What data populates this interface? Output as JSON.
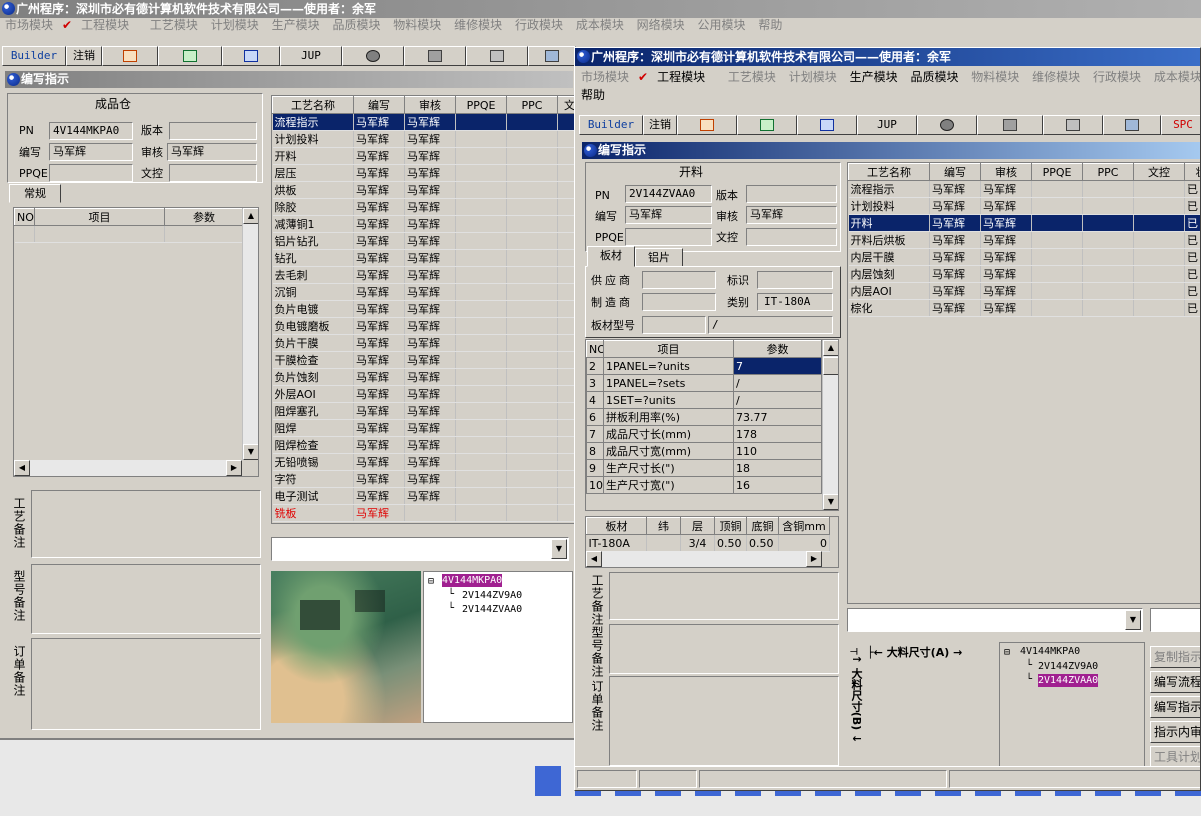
{
  "app_title": "广州程序：深圳市必有德计算机软件技术有限公司——使用者：余军",
  "menu": [
    "市场模块",
    "工程模块",
    "工艺模块",
    "计划模块",
    "生产模块",
    "品质模块",
    "物料模块",
    "维修模块",
    "行政模块",
    "成本模块",
    "网络模块",
    "公用模块",
    "帮助"
  ],
  "menu_front": [
    "市场模块",
    "工程模块",
    "工艺模块",
    "计划模块",
    "生产模块",
    "品质模块",
    "物料模块",
    "维修模块",
    "行政模块",
    "成本模块"
  ],
  "menu_front_help": "帮助",
  "toolbar": {
    "builder": "Builder",
    "logout": "注销",
    "jup": "JUP",
    "spc": "SPC"
  },
  "doc_title": "编写指示",
  "back": {
    "section": "成品仓",
    "pn_label": "PN",
    "pn": "4V144MKPA0",
    "ver_label": "版本",
    "ver": "",
    "writer_label": "编写",
    "writer": "马军辉",
    "review_label": "审核",
    "review": "马军辉",
    "ppqe_label": "PPQE",
    "ppqe": "",
    "doc_label": "文控",
    "doc": "",
    "tab": "常规",
    "param_headers": [
      "NO",
      "项目",
      "参数"
    ],
    "process_headers": [
      "工艺名称",
      "编写",
      "审核",
      "PPQE",
      "PPC",
      "文"
    ],
    "processes": [
      [
        "流程指示",
        "马军辉",
        "马军辉"
      ],
      [
        "计划投料",
        "马军辉",
        "马军辉"
      ],
      [
        "开料",
        "马军辉",
        "马军辉"
      ],
      [
        "层压",
        "马军辉",
        "马军辉"
      ],
      [
        "烘板",
        "马军辉",
        "马军辉"
      ],
      [
        "除胶",
        "马军辉",
        "马军辉"
      ],
      [
        "减薄铜1",
        "马军辉",
        "马军辉"
      ],
      [
        "铝片钻孔",
        "马军辉",
        "马军辉"
      ],
      [
        "钻孔",
        "马军辉",
        "马军辉"
      ],
      [
        "去毛刺",
        "马军辉",
        "马军辉"
      ],
      [
        "沉铜",
        "马军辉",
        "马军辉"
      ],
      [
        "负片电镀",
        "马军辉",
        "马军辉"
      ],
      [
        "负电镀磨板",
        "马军辉",
        "马军辉"
      ],
      [
        "负片干膜",
        "马军辉",
        "马军辉"
      ],
      [
        "干膜检查",
        "马军辉",
        "马军辉"
      ],
      [
        "负片蚀刻",
        "马军辉",
        "马军辉"
      ],
      [
        "外层AOI",
        "马军辉",
        "马军辉"
      ],
      [
        "阻焊塞孔",
        "马军辉",
        "马军辉"
      ],
      [
        "阻焊",
        "马军辉",
        "马军辉"
      ],
      [
        "阻焊检查",
        "马军辉",
        "马军辉"
      ],
      [
        "无铅喷锡",
        "马军辉",
        "马军辉"
      ],
      [
        "字符",
        "马军辉",
        "马军辉"
      ],
      [
        "电子测试",
        "马军辉",
        "马军辉"
      ],
      [
        "铣板",
        "马军辉",
        ""
      ]
    ],
    "notes": [
      "工艺备注",
      "型号备注",
      "订单备注"
    ],
    "tree": [
      "4V144MKPA0",
      "2V144ZV9A0",
      "2V144ZVAA0"
    ]
  },
  "front": {
    "section": "开料",
    "pn_label": "PN",
    "pn": "2V144ZVAA0",
    "ver_label": "版本",
    "ver": "",
    "writer_label": "编写",
    "writer": "马军辉",
    "review_label": "审核",
    "review": "马军辉",
    "ppqe_label": "PPQE",
    "ppqe": "",
    "doc_label": "文控",
    "doc": "",
    "tabs": [
      "板材",
      "铝片"
    ],
    "supplier_label": "供应商",
    "supplier": "",
    "mark_label": "标识",
    "mark": "",
    "maker_label": "制造商",
    "maker": "",
    "type_label": "类别",
    "type": "IT-180A",
    "model_label": "板材型号",
    "model": "",
    "model2": "/",
    "param_headers": [
      "NO",
      "项目",
      "参数"
    ],
    "params": [
      [
        "2",
        "1PANEL=?units",
        "7"
      ],
      [
        "3",
        "1PANEL=?sets",
        "/"
      ],
      [
        "4",
        "1SET=?units",
        "/"
      ],
      [
        "6",
        "拼板利用率(%)",
        "73.77"
      ],
      [
        "7",
        "成品尺寸长(mm)",
        "178"
      ],
      [
        "8",
        "成品尺寸宽(mm)",
        "110"
      ],
      [
        "9",
        "生产尺寸长(\")",
        "18"
      ],
      [
        "10",
        "生产尺寸宽(\")",
        "16"
      ]
    ],
    "mat_headers": [
      "板材",
      "纬",
      "层",
      "顶铜",
      "底铜",
      "含铜mm"
    ],
    "mat_row": [
      "IT-180A",
      "",
      "3/4",
      "0.50",
      "0.50",
      "0"
    ],
    "process_headers": [
      "工艺名称",
      "编写",
      "审核",
      "PPQE",
      "PPC",
      "文控",
      "状"
    ],
    "processes": [
      [
        "流程指示",
        "马军辉",
        "马军辉",
        "已"
      ],
      [
        "计划投料",
        "马军辉",
        "马军辉",
        "已"
      ],
      [
        "开料",
        "马军辉",
        "马军辉",
        "已"
      ],
      [
        "开料后烘板",
        "马军辉",
        "马军辉",
        "已"
      ],
      [
        "内层干膜",
        "马军辉",
        "马军辉",
        "已"
      ],
      [
        "内层蚀刻",
        "马军辉",
        "马军辉",
        "已"
      ],
      [
        "内层AOI",
        "马军辉",
        "马军辉",
        "已"
      ],
      [
        "棕化",
        "马军辉",
        "马军辉",
        "已"
      ]
    ],
    "notes": [
      "工艺备注",
      "型号备注",
      "订单备注"
    ],
    "dim_a": "大料尺寸(A)",
    "dim_b": "大料尺寸(B)",
    "tree": [
      "4V144MKPA0",
      "2V144ZV9A0",
      "2V144ZVAA0"
    ],
    "side_buttons": [
      "复制指示",
      "编写流程",
      "编写指示",
      "指示内审",
      "工具计划"
    ]
  },
  "colors": {
    "title_active": "#0a246a",
    "title_inactive": "#808080",
    "selection": "#0a246a",
    "tree_highlight": "#a02090",
    "red_text": "#e00000"
  }
}
